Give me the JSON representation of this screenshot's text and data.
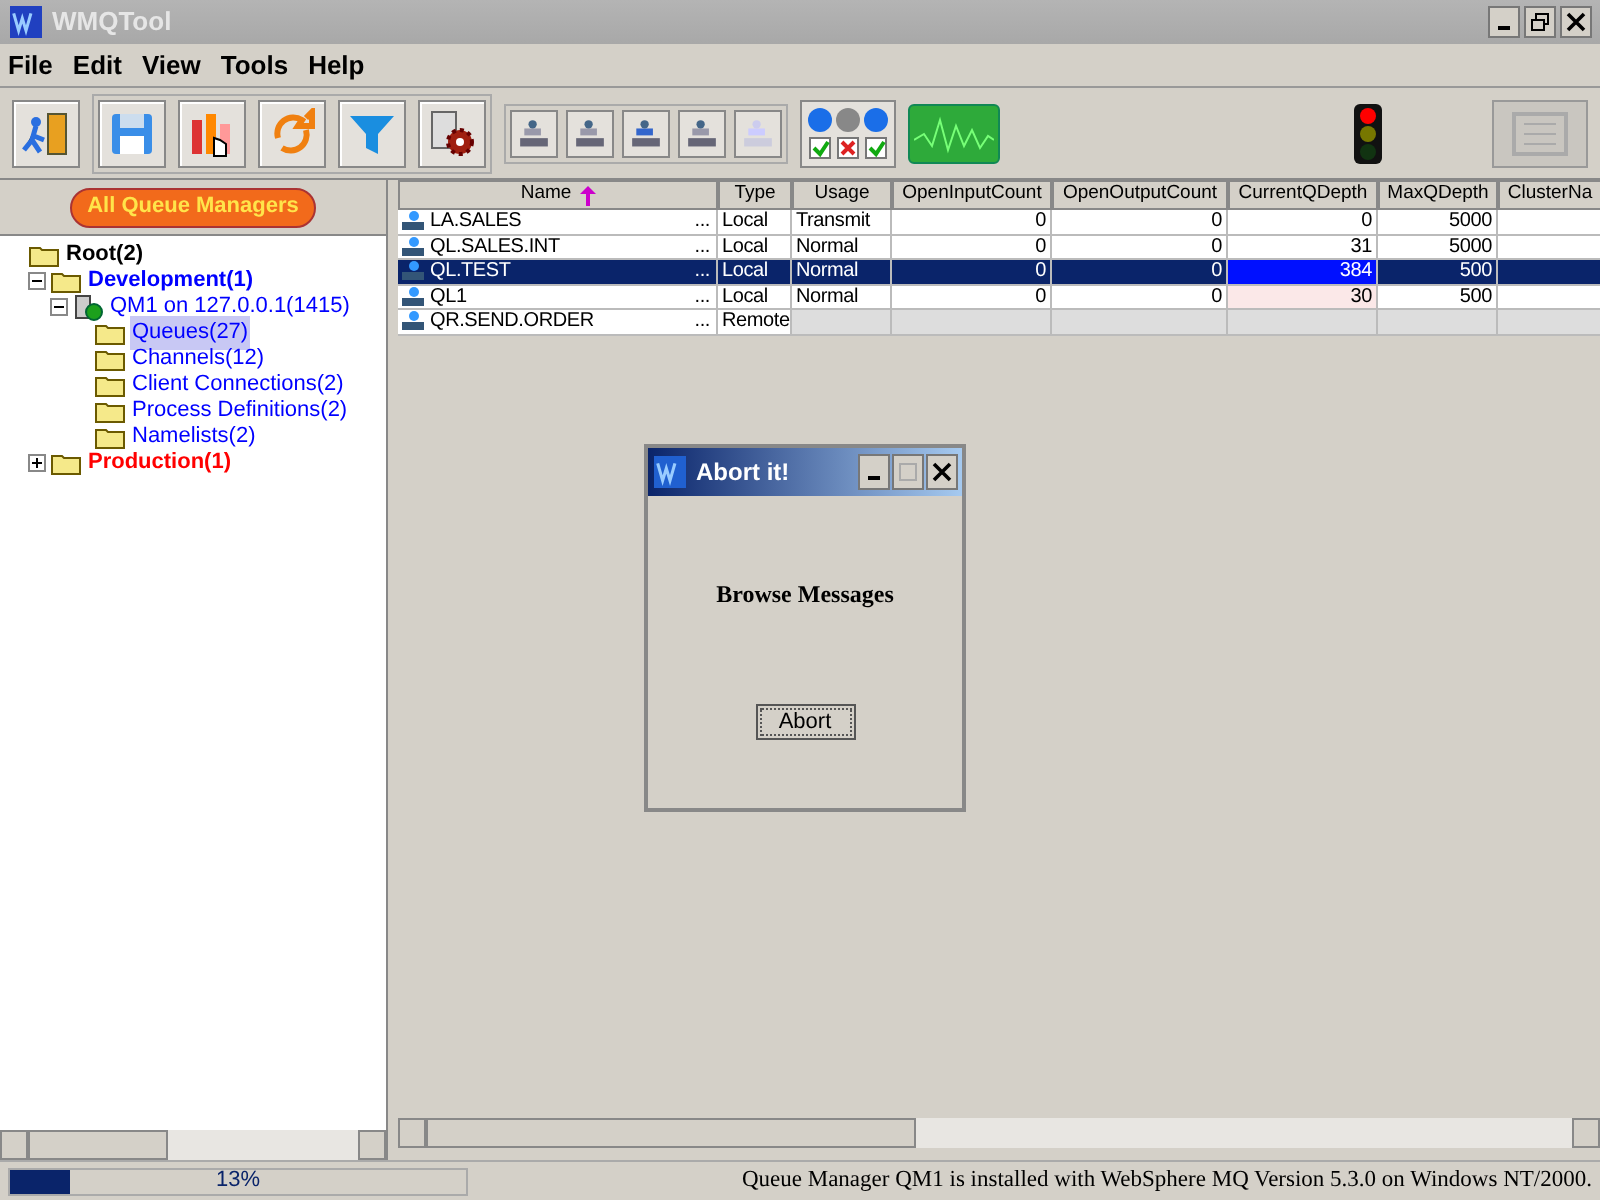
{
  "window": {
    "title": "WMQTool"
  },
  "menu": [
    "File",
    "Edit",
    "View",
    "Tools",
    "Help"
  ],
  "sidebar": {
    "button": "All Queue Managers",
    "tree": [
      {
        "label": "Root(2)",
        "kind": "folder",
        "color": "#000000",
        "children": [
          {
            "label": "Development(1)",
            "kind": "folder",
            "color": "#0000ff",
            "expanded": true,
            "children": [
              {
                "label": "QM1  on 127.0.0.1(1415)",
                "kind": "queue_manager",
                "color": "#0000ff",
                "expanded": true,
                "children": [
                  {
                    "label": "Queues(27)",
                    "kind": "folder",
                    "color": "#0000ff",
                    "selected": true
                  },
                  {
                    "label": "Channels(12)",
                    "kind": "folder",
                    "color": "#0000ff",
                    "selected": false
                  },
                  {
                    "label": "Client Connections(2)",
                    "kind": "folder",
                    "color": "#0000ff",
                    "selected": false
                  },
                  {
                    "label": "Process Definitions(2)",
                    "kind": "folder",
                    "color": "#0000ff",
                    "selected": false
                  },
                  {
                    "label": "Namelists(2)",
                    "kind": "folder",
                    "color": "#0000ff",
                    "selected": false
                  }
                ]
              }
            ]
          },
          {
            "label": "Production(1)",
            "kind": "folder",
            "color": "#ff0000",
            "expanded": false
          }
        ]
      }
    ]
  },
  "table": {
    "columns": [
      "Name",
      "Type",
      "Usage",
      "OpenInputCount",
      "OpenOutputCount",
      "CurrentQDepth",
      "MaxQDepth",
      "ClusterNa"
    ],
    "rows": [
      {
        "kind": "local",
        "selected": false,
        "depth_alert": false,
        "more": "...",
        "cells": [
          "LA.SALES",
          "Local",
          "Transmit",
          "0",
          "0",
          "0",
          "5000"
        ]
      },
      {
        "kind": "local",
        "selected": false,
        "depth_alert": false,
        "more": "...",
        "cells": [
          "QL.SALES.INT",
          "Local",
          "Normal",
          "0",
          "0",
          "31",
          "5000"
        ]
      },
      {
        "kind": "local",
        "selected": true,
        "depth_alert": true,
        "more": "...",
        "cells": [
          "QL.TEST",
          "Local",
          "Normal",
          "0",
          "0",
          "384",
          "500"
        ]
      },
      {
        "kind": "local",
        "selected": false,
        "depth_alert": true,
        "more": "...",
        "cells": [
          "QL1",
          "Local",
          "Normal",
          "0",
          "0",
          "30",
          "500"
        ]
      },
      {
        "kind": "remote",
        "selected": false,
        "depth_alert": false,
        "more": "...",
        "cells": [
          "QR.SEND.ORDER",
          "Remote"
        ]
      }
    ]
  },
  "dialog": {
    "title": "Abort it!",
    "message": "Browse Messages",
    "button": "Abort"
  },
  "status_bar": {
    "level": 0.13,
    "percent": "13%",
    "message": "Queue Manager QM1  is installed with WebSphere MQ Version 5.3.0 on Windows NT/2000."
  }
}
